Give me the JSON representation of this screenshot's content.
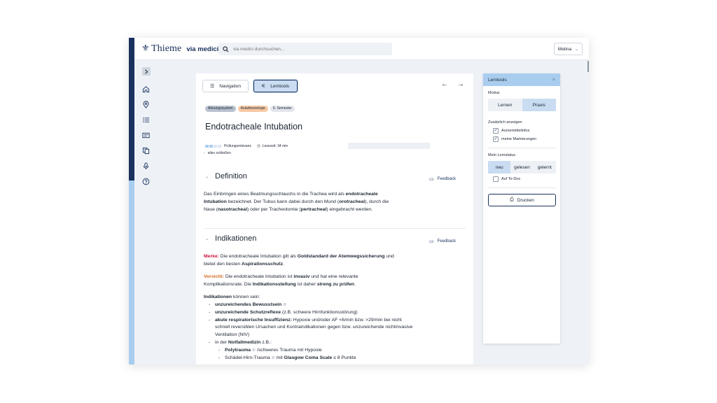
{
  "app": {
    "logo_text": "Thieme",
    "logo_sub": "via medici",
    "search_placeholder": "via medici durchsuchen...",
    "user_name": "Melina"
  },
  "toolbar": {
    "navigation_label": "Navigation",
    "lerntools_label": "Lerntools"
  },
  "article": {
    "tags": [
      "Atmungssystem",
      "Anästhesiologie",
      "6. Semester"
    ],
    "title": "Endotracheale Intubation",
    "relevance_label": "Prüfungsrelevanz",
    "reading_time": "Lesezeit: 34 min",
    "collapse_all": "alles schließen",
    "feedback_label": "Feedback",
    "sections": [
      {
        "title": "Definition",
        "paragraph": {
          "t1": "Das Einbringen eines Beatmungsschlauchs in die Trachea wird als ",
          "b1": "endotracheale Intubation",
          "t2": " bezeichnet. Der Tubus kann dabei durch den Mund (",
          "b2": "orotracheal",
          "t3": "), durch die Nase (",
          "b3": "nasotracheal",
          "t4": ") oder per Tracheotomie (",
          "b4": "pertracheal",
          "t5": ") eingebracht werden."
        }
      },
      {
        "title": "Indikationen",
        "merke": {
          "label": "Merke:",
          "t1": " Die endotracheale Intubation gilt als ",
          "b1": "Goldstandard der Atemwegssicherung",
          "t2": " und bietet den besten ",
          "b2": "Aspirationsschutz",
          "t3": "."
        },
        "vorsicht": {
          "label": "Vorsicht:",
          "t1": " Die endotracheale Intubation ist ",
          "b1": "invasiv",
          "t2": " und hat eine relevante Komplikationsrate. Die ",
          "b2": "Indikationsstellung",
          "t3": " ist daher ",
          "b3": "streng zu prüfen",
          "t4": "."
        },
        "list_intro_bold": "Indikationen",
        "list_intro_rest": " können sein:",
        "items": {
          "i1_b": "unzureichendes Bewusstsein",
          "i2_b": "unzureichende Schutzreflexe",
          "i2_t": " (z.B. schwere Hirnfunktionsstörung)",
          "i3_b": "akute respiratorische Insuffizienz:",
          "i3_t": " Hypoxie und/oder AF <6/min bzw. >29/min bei nicht schnell reversiblen Ursachen und Kontraindikationen gegen bzw. unzureichende nichtinvasive Ventilation (NIV)",
          "i4_t": "in der ",
          "i4_b": "Notfallmedizin",
          "i4_t2": " z.B.:",
          "s1_b": "Polytrauma",
          "s1_t": "/schweres Trauma mit Hypoxie",
          "s2_t": "Schädel-Hirn-Trauma",
          "s2_t2": " mit ",
          "s2_b": "Glasgow Coma Scale",
          "s2_t3": " ≤ 8 Punkte"
        }
      }
    ]
  },
  "panel": {
    "title": "Lerntools",
    "modus_label": "Modus",
    "modus_options": [
      "Lernen",
      "Praxis"
    ],
    "extra_label": "Zusätzlich anzeigen",
    "extra_options": [
      "Arzneimittelinfos",
      "meine Markierungen"
    ],
    "status_label": "Mein Lernstatus",
    "status_options": [
      "neu",
      "gelesen",
      "gelernt"
    ],
    "todo_label": "Auf To-Dos",
    "print_label": "Drucken"
  },
  "colors": {
    "brand": "#19315c",
    "accent": "#a9cdef",
    "merke": "#c8143c",
    "vorsicht": "#d2691e"
  }
}
